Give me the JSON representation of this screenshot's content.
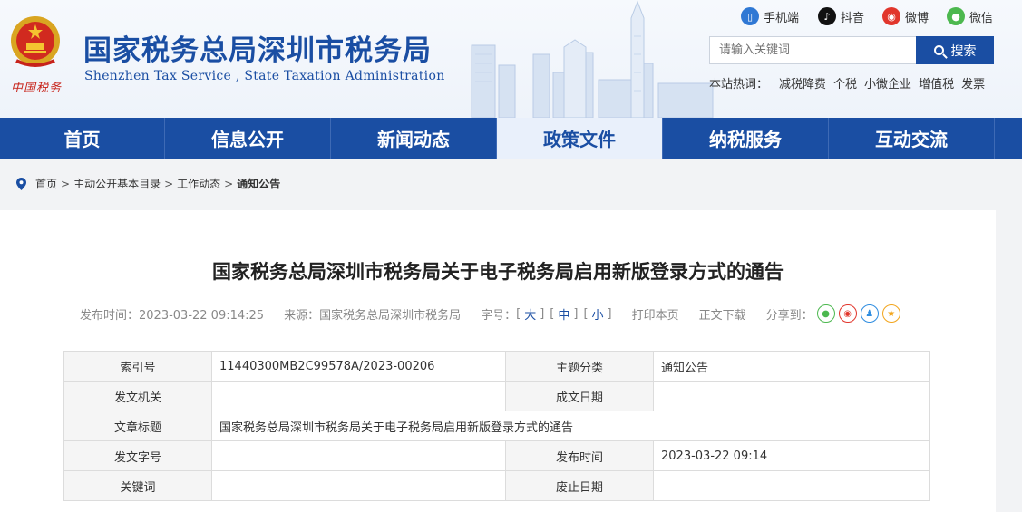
{
  "header": {
    "title": "国家税务总局深圳市税务局",
    "subtitle": "Shenzhen Tax Service , State Taxation Administration",
    "emblem_caption": "中国税务",
    "social": {
      "mobile": "手机端",
      "douyin": "抖音",
      "weibo": "微博",
      "wechat": "微信"
    },
    "search": {
      "placeholder": "请输入关键词",
      "button": "搜索"
    },
    "hot": {
      "label": "本站热词：",
      "terms": [
        "减税降费",
        "个税",
        "小微企业",
        "增值税",
        "发票"
      ]
    }
  },
  "nav": [
    "首页",
    "信息公开",
    "新闻动态",
    "政策文件",
    "纳税服务",
    "互动交流"
  ],
  "nav_active": "政策文件",
  "breadcrumb": [
    "首页",
    "主动公开基本目录",
    "工作动态",
    "通知公告"
  ],
  "article": {
    "title": "国家税务总局深圳市税务局关于电子税务局启用新版登录方式的通告",
    "meta": {
      "publish": "发布时间：2023-03-22 09:14:25",
      "source": "来源：国家税务总局深圳市税务局",
      "fontsize_label": "字号：",
      "size_large": "大",
      "size_medium": "中",
      "size_small": "小",
      "print": "打印本页",
      "download": "正文下载",
      "share": "分享到："
    },
    "info": {
      "index_label": "索引号",
      "index_value": "11440300MB2C99578A/2023-00206",
      "topic_label": "主题分类",
      "topic_value": "通知公告",
      "issuer_label": "发文机关",
      "issuer_value": "",
      "date_label": "成文日期",
      "date_value": "",
      "subject_label": "文章标题",
      "subject_value": "国家税务总局深圳市税务局关于电子税务局启用新版登录方式的通告",
      "docno_label": "发文字号",
      "docno_value": "",
      "pubtime_label": "发布时间",
      "pubtime_value": "2023-03-22 09:14",
      "keywords_label": "关键词",
      "keywords_value": "",
      "expiry_label": "废止日期",
      "expiry_value": ""
    }
  },
  "colors": {
    "brand_blue": "#1a4ea3",
    "active_nav_bg": "#e9f0fb"
  }
}
